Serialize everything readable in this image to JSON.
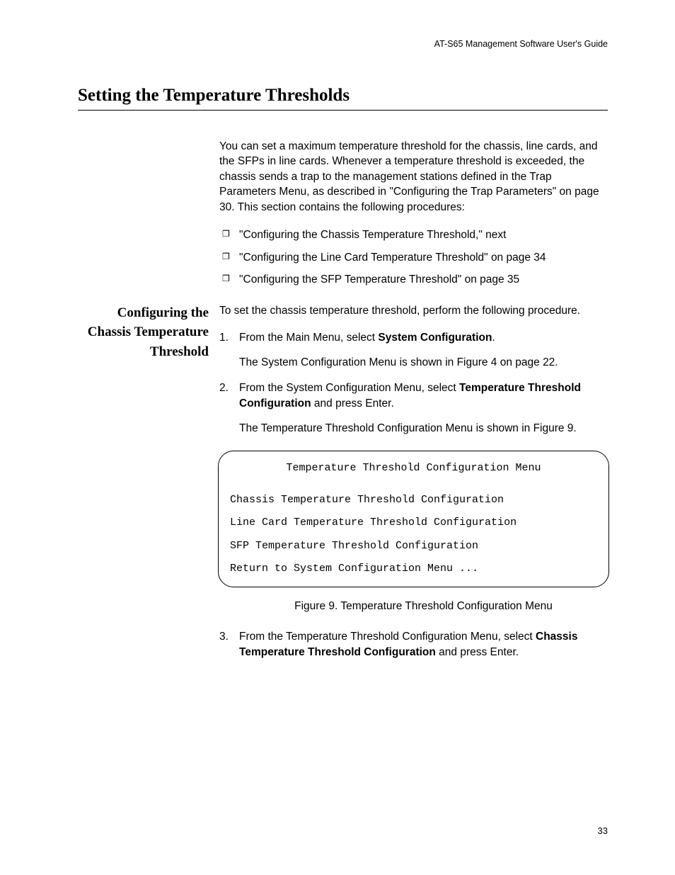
{
  "header": "AT-S65 Management Software User's Guide",
  "sectionTitle": "Setting the Temperature Thresholds",
  "intro": "You can set a maximum temperature threshold for the chassis, line cards, and the SFPs in line cards. Whenever a temperature threshold is exceeded, the chassis sends a trap to the management stations defined in the Trap Parameters Menu, as described in \"Configuring the Trap Parameters\" on page 30. This section contains the following procedures:",
  "bullets": [
    "\"Configuring the Chassis Temperature Threshold,\"  next",
    "\"Configuring the Line Card Temperature Threshold\" on page 34",
    "\"Configuring the SFP Temperature Threshold\" on page 35"
  ],
  "marginHeading": "Configuring the Chassis Temperature Threshold",
  "lead": "To set the chassis temperature threshold, perform the following procedure.",
  "steps": {
    "s1a": "From the Main Menu, select ",
    "s1b": "System Configuration",
    "s1c": ".",
    "s1note": "The System Configuration Menu is shown in Figure 4 on page 22.",
    "s2a": "From the System Configuration Menu, select ",
    "s2b": "Temperature Threshold Configuration",
    "s2c": " and press Enter.",
    "s2note": "The Temperature Threshold Configuration Menu is shown in Figure 9.",
    "s3a": "From the Temperature Threshold Configuration Menu, select ",
    "s3b": "Chassis Temperature Threshold Configuration",
    "s3c": " and press Enter."
  },
  "menu": {
    "title": "Temperature Threshold Configuration Menu",
    "lines": [
      "Chassis Temperature Threshold Configuration",
      "Line Card Temperature Threshold Configuration",
      "SFP Temperature Threshold Configuration",
      "Return to System Configuration Menu ..."
    ]
  },
  "figureCaption": "Figure 9. Temperature Threshold Configuration Menu",
  "pageNumber": "33"
}
